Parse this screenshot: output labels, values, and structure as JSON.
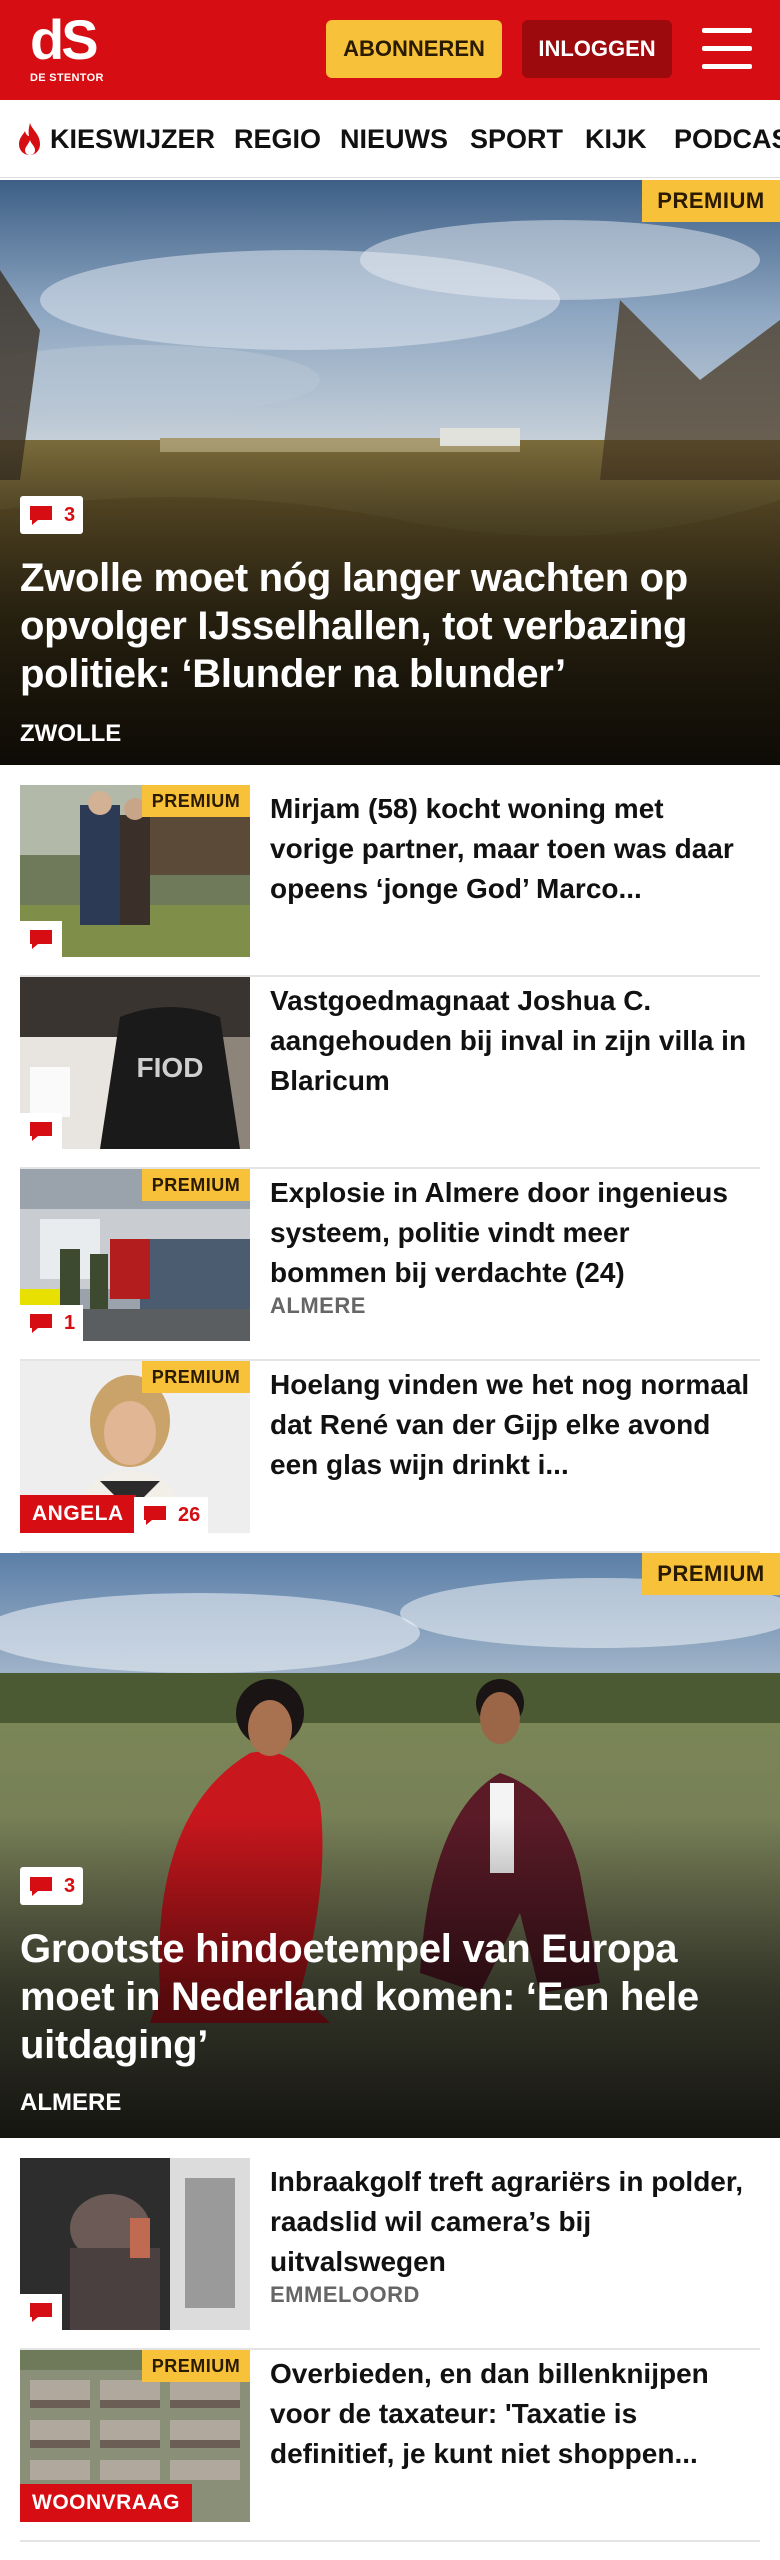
{
  "header": {
    "logo_mark": "dS",
    "logo_subtitle": "DE STENTOR",
    "subscribe_label": "ABONNEREN",
    "login_label": "INLOGGEN"
  },
  "nav": {
    "items": [
      "KIESWIJZER",
      "REGIO",
      "NIEUWS",
      "SPORT",
      "KIJK",
      "PODCASTS"
    ]
  },
  "colors": {
    "brand_red": "#d60d12",
    "premium_yellow": "#f8c13a",
    "login_dark_red": "#9c0a0e"
  },
  "hero1": {
    "badge": "PREMIUM",
    "comments": "3",
    "title": "Zwolle moet nóg langer wachten op opvolger IJsselhallen, tot verbazing politiek: ‘Blunder na blunder’",
    "category": "ZWOLLE"
  },
  "list1": [
    {
      "title": "Mirjam (58) kocht woning met vorige partner, maar toen was daar opeens ‘jonge God’ Marco...",
      "badge": "PREMIUM",
      "comments": ""
    },
    {
      "title": "Vastgoedmagnaat Joshua C. aangehouden bij inval in zijn villa in Blaricum",
      "badge": "",
      "comments": ""
    },
    {
      "title": "Explosie in Almere door ingenieus systeem, politie vindt meer bommen bij verdachte (24)",
      "badge": "PREMIUM",
      "comments": "1",
      "location": "ALMERE"
    },
    {
      "title": "Hoelang vinden we het nog normaal dat René van der Gijp elke avond een glas wijn drinkt i...",
      "badge": "PREMIUM",
      "comments": "26",
      "tag": "ANGELA"
    }
  ],
  "hero2": {
    "badge": "PREMIUM",
    "comments": "3",
    "title": "Grootste hindoetempel van Europa moet in Nederland komen: ‘Een hele uitdaging’",
    "category": "ALMERE"
  },
  "list2": [
    {
      "title": "Inbraakgolf treft agrariërs in polder, raadslid wil camera’s bij uitvalswegen",
      "badge": "",
      "comments": "",
      "location": "EMMELOORD"
    },
    {
      "title": "Overbieden, en dan billenknijpen voor de taxateur: 'Taxatie is definitief, je kunt niet shoppen...",
      "badge": "PREMIUM",
      "tag": "WOONVRAAG"
    }
  ]
}
